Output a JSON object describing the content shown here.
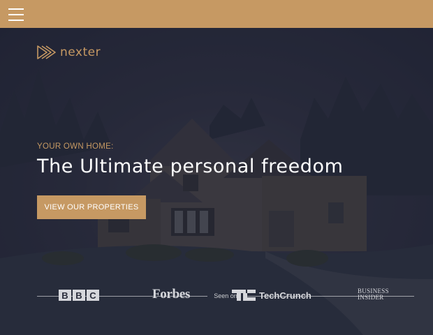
{
  "header": {
    "background_color": "#c69963",
    "menu_icon": "hamburger-menu-icon"
  },
  "logo": {
    "icon": "triple-play-arrow-icon",
    "text": "nexter"
  },
  "hero": {
    "subheading": "YOUR OWN HOME:",
    "heading": "The Ultimate personal freedom",
    "cta_label": "VIEW OUR PROPERTIES",
    "accent_color": "#c69963"
  },
  "seen_on": {
    "label": "Seen on",
    "logos": {
      "bbc": [
        "B",
        "B",
        "C"
      ],
      "forbes": "Forbes",
      "techcrunch": "TechCrunch",
      "business_insider": [
        "BUSINESS",
        "INSIDER"
      ]
    }
  }
}
